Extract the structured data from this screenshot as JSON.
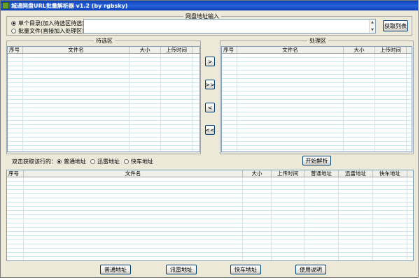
{
  "window": {
    "title": "城通网盘URL批量解析器 v1.2 (by rgbsky)"
  },
  "input_group": {
    "label": "网盘地址输入",
    "radio_single": "单个目录(加入待选区待选)",
    "radio_batch": "批量文件(直接加入处理区)",
    "url_value": "",
    "get_list_button": "获取列表"
  },
  "pending": {
    "label": "待选区",
    "columns": [
      "序号",
      "文件名",
      "大小",
      "上传时间"
    ]
  },
  "processing": {
    "label": "处理区",
    "columns": [
      "序号",
      "文件名",
      "大小",
      "上传时间"
    ]
  },
  "transfer": {
    "move_right": ">",
    "move_all_right": ">>",
    "move_left": "<",
    "move_all_left": "<<"
  },
  "dblclick": {
    "label": "双击获取该行的：",
    "opt_normal": "普通地址",
    "opt_xunlei": "迅雷地址",
    "opt_kuaiche": "快车地址"
  },
  "start_button": "开始解析",
  "results": {
    "columns": [
      "序号",
      "文件名",
      "大小",
      "上传时间",
      "普通地址",
      "迅雷地址",
      "快车地址"
    ]
  },
  "bottom_buttons": {
    "normal": "普通地址",
    "xunlei": "讯雷地址",
    "kuaiche": "快车地址",
    "help": "使用说明"
  }
}
